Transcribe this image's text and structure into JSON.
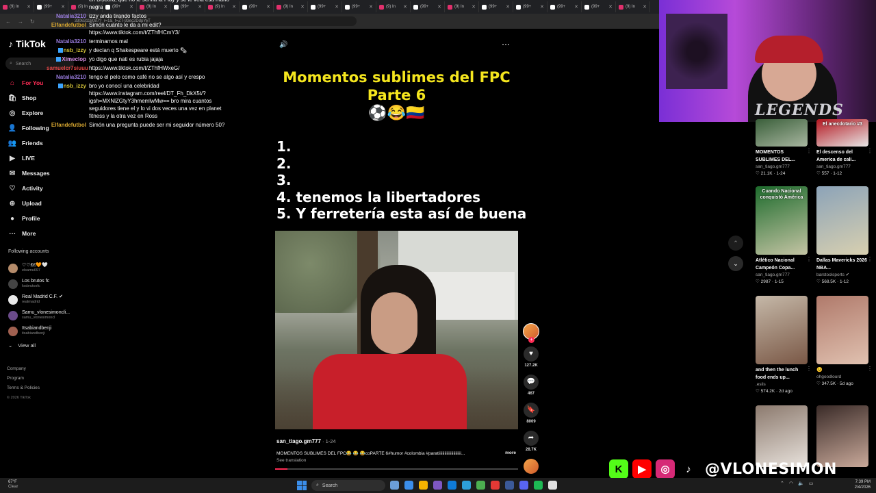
{
  "browser": {
    "tabs": [
      {
        "label": "(9) In",
        "color": "#e1306c"
      },
      {
        "label": "(99+",
        "color": "#ffffff"
      },
      {
        "label": "(9) In",
        "color": "#e1306c"
      },
      {
        "label": "(99+",
        "color": "#ffffff"
      },
      {
        "label": "(9) In",
        "color": "#e1306c"
      },
      {
        "label": "(99+",
        "color": "#ffffff"
      },
      {
        "label": "(9) In",
        "color": "#e1306c"
      },
      {
        "label": "(99+",
        "color": "#ffffff"
      },
      {
        "label": "(9) In",
        "color": "#e1306c"
      },
      {
        "label": "(99+",
        "color": "#ffffff"
      },
      {
        "label": "(99+",
        "color": "#ffffff"
      },
      {
        "label": "(9) In",
        "color": "#e1306c"
      },
      {
        "label": "(99+",
        "color": "#ffffff"
      },
      {
        "label": "(9) In",
        "color": "#e1306c"
      },
      {
        "label": "(99+",
        "color": "#ffffff"
      },
      {
        "label": "(99+",
        "color": "#ffffff"
      },
      {
        "label": "(99+",
        "color": "#ffffff"
      },
      {
        "label": "(99+",
        "color": "#ffffff"
      },
      {
        "label": "(9) In",
        "color": "#e1306c"
      }
    ],
    "url": "33063118087?_r=1&_t=ZT-93ec2DdpYeT"
  },
  "sidebar": {
    "logo": "TikTok",
    "search_placeholder": "Search",
    "nav": [
      {
        "label": "For You",
        "icon": "home-icon",
        "glyph": "⌂",
        "active": true
      },
      {
        "label": "Shop",
        "icon": "shop-icon",
        "glyph": "🛍"
      },
      {
        "label": "Explore",
        "icon": "compass-icon",
        "glyph": "◎"
      },
      {
        "label": "Following",
        "icon": "following-icon",
        "glyph": "👤"
      },
      {
        "label": "Friends",
        "icon": "friends-icon",
        "glyph": "👥"
      },
      {
        "label": "LIVE",
        "icon": "live-icon",
        "glyph": "▶"
      },
      {
        "label": "Messages",
        "icon": "messages-icon",
        "glyph": "✉"
      },
      {
        "label": "Activity",
        "icon": "activity-icon",
        "glyph": "♡"
      },
      {
        "label": "Upload",
        "icon": "upload-icon",
        "glyph": "⊕"
      },
      {
        "label": "Profile",
        "icon": "profile-icon",
        "glyph": "●"
      },
      {
        "label": "More",
        "icon": "more-icon",
        "glyph": "⋯"
      }
    ],
    "following_title": "Following accounts",
    "accounts": [
      {
        "name": "♡♡££🧡🤍",
        "handle": "elsamu697"
      },
      {
        "name": "Los brutos fc",
        "handle": "losbrutosfc"
      },
      {
        "name": "Real Madrid C.F. ✔",
        "handle": "realmadrid"
      },
      {
        "name": "Samu_vlonesimoncli...",
        "handle": "samu_vlonesimoncl"
      },
      {
        "name": "Itsabiandbenji",
        "handle": "itsabiandbenji"
      }
    ],
    "view_all": "View all",
    "footer": [
      "Company",
      "Program",
      "Terms & Policies"
    ],
    "copyright": "© 2026 TikTok"
  },
  "chat": [
    {
      "user": "",
      "color": "#ffffff",
      "text": "en Discord, que no le servia la Play y se le veia esa mano negra"
    },
    {
      "user": "Natalia3210",
      "color": "#9b7de0",
      "text": "izzy anda tirando factos"
    },
    {
      "user": "Elfandefutbol",
      "color": "#d8a730",
      "text": "Simón cuanto le da a mi edit? https://www.tiktok.com/t/ZThfHCmY3/"
    },
    {
      "user": "Natalia3210",
      "color": "#9b7de0",
      "text": "terminamos mal"
    },
    {
      "user": "nsb_izzy",
      "color": "#d8c73a",
      "badge": true,
      "text": "y decían q Shakespeare está muerto 🗞"
    },
    {
      "user": "Ximeclop",
      "color": "#d18be0",
      "badge": true,
      "text": "yo digo que nati es rubia jajaja"
    },
    {
      "user": "samuelcr7siuuu",
      "color": "#e04646",
      "text": "https://www.tiktok.com/t/ZThfHWxeG/"
    },
    {
      "user": "Natalia3210",
      "color": "#9b7de0",
      "text": "tengo el pelo como café no se algo así y crespo"
    },
    {
      "user": "nsb_izzy",
      "color": "#d8c73a",
      "badge": true,
      "text": "bro yo conocí una celebridad https://www.instagram.com/reel/DT_Fh_DkX5t/?igsh=MXNlZGtyY3hmemlwMw== bro mira cuantos seguidores tiene el y lo vi dos veces una vez en planet fitness y la otra vez en Ross"
    },
    {
      "user": "Elfandefutbol",
      "color": "#d8a730",
      "text": "Simón una pregunta puede ser mi seguidor número 50?"
    }
  ],
  "video": {
    "title_line1": "Momentos sublimes del FPC",
    "title_line2": "Parte 6",
    "emojis": "⚽😂🇨🇴",
    "list": [
      "1.",
      "2.",
      "3.",
      "4.  tenemos la libertadores",
      "5.  Y ferretería esta así de buena"
    ],
    "author": "san_tiago.gm777",
    "date": "· 1-24",
    "description": "MOMENTOS SUBLIMES DEL FPC😂 😂 😂coPARTE 6#humor #colombia  #paratiiiiiiiiiiiiiiiiiiiiiii...",
    "more": "more",
    "see_translation": "See translation",
    "progress": 0.05,
    "likes": "127.2K",
    "comments": "467",
    "saves": "8009",
    "shares": "28.7K"
  },
  "suggestions": [
    {
      "title": "MOMENTOS SUBLIMES DEL...",
      "author": "san_tiago.gm777",
      "stats": "♡ 21.1K · 1-24",
      "colors": [
        "#3a5f3a",
        "#a8b6a0"
      ]
    },
    {
      "title": "El descenso del America de cali...",
      "author": "san_tiago.gm777",
      "stats": "♡ 557 · 1-12",
      "overlay": "El anecdotario #3",
      "colors": [
        "#b4161f",
        "#e7e7e7"
      ]
    },
    {
      "title": "Atlético Nacional Campeón Copa...",
      "author": "san_tiago.gm777",
      "stats": "♡ 2987 · 1-15",
      "overlay": "Cuando Nacional conquistó América",
      "colors": [
        "#1d6b2c",
        "#c4c4a4"
      ]
    },
    {
      "title": "Dallas Mavericks 2026 NBA...",
      "author": "barstoolsports ✔",
      "stats": "♡ 568.5K · 1-12",
      "colors": [
        "#8ca3b8",
        "#d8d0b0"
      ]
    },
    {
      "title": "and then the lunch food ends up...",
      "author": ".eslis",
      "stats": "♡ 574.2K · 2d ago",
      "colors": [
        "#c5b8a8",
        "#7a5846"
      ]
    },
    {
      "title": "😉",
      "author": "ohgoodlourd",
      "stats": "♡ 347.5K · 5d ago",
      "colors": [
        "#b07a6b",
        "#e0c1b0"
      ]
    },
    {
      "title": "",
      "author": "",
      "stats": "",
      "colors": [
        "#8c7a6e",
        "#e8e2dc"
      ]
    },
    {
      "title": "",
      "author": "",
      "stats": "",
      "colors": [
        "#3a2b28",
        "#c9a99a"
      ]
    }
  ],
  "banner": {
    "handle": "@VLONESIMON",
    "kick_color": "#53fc18",
    "youtube_color": "#ff0000",
    "instagram_color": "#d62976"
  },
  "cam": {
    "overlay_text": "LEGENDS"
  },
  "taskbar": {
    "weather_temp": "67°F",
    "weather_desc": "Clear",
    "search": "Search",
    "time": "7:39 PM",
    "date": "2/4/2026",
    "apps": [
      "#6b9ed8",
      "#3b8eea",
      "#f5b400",
      "#7e57c2",
      "#0f7bd8",
      "#2d9fd8",
      "#4caf50",
      "#e53935",
      "#3b5998",
      "#5865f2",
      "#1db954",
      "#e0e0e0"
    ]
  }
}
